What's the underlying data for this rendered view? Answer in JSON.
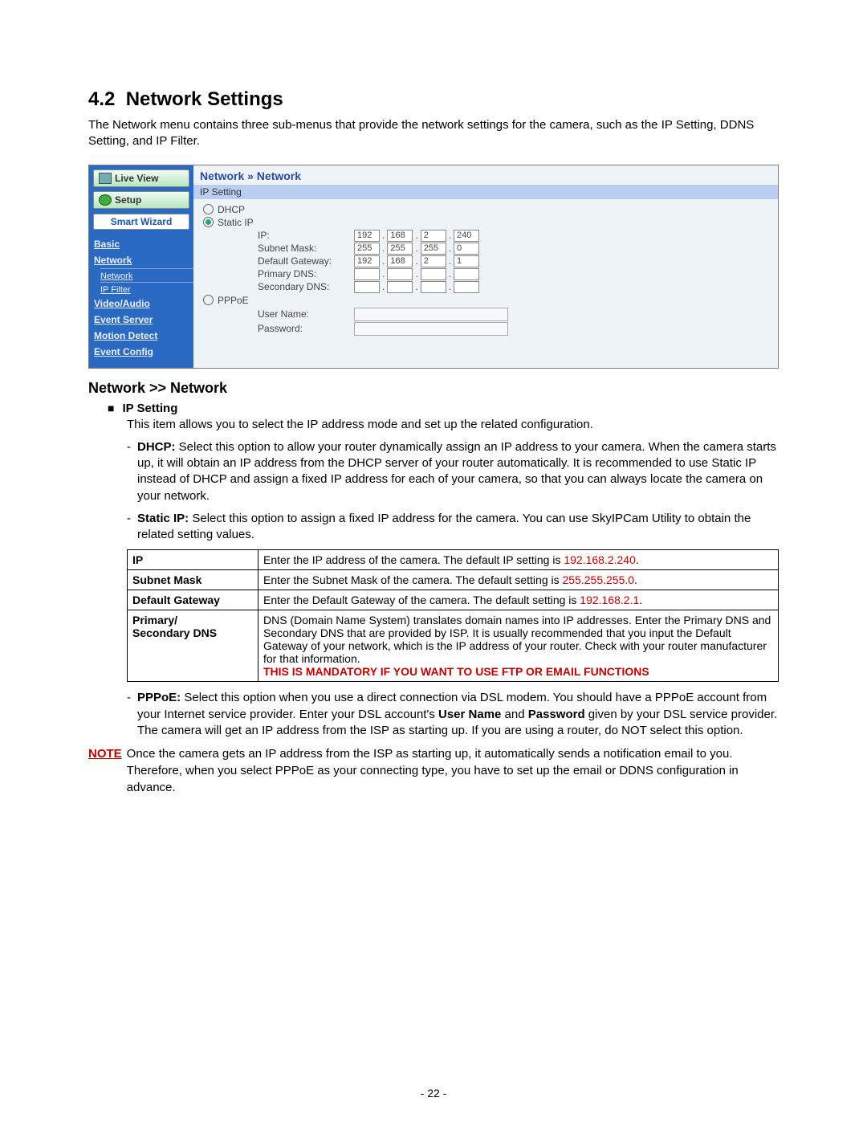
{
  "section": {
    "number": "4.2",
    "title": "Network Settings",
    "intro": "The Network menu contains three sub-menus that provide the network settings for the camera, such as the IP Setting, DDNS Setting, and IP Filter."
  },
  "ui": {
    "sidebar": {
      "live_view": "Live View",
      "setup": "Setup",
      "smart_wizard": "Smart Wizard",
      "items": [
        "Basic",
        "Network",
        "Video/Audio",
        "Event Server",
        "Motion Detect",
        "Event Config"
      ],
      "network_sub": [
        "Network",
        "IP Filter"
      ]
    },
    "breadcrumb": "Network » Network",
    "banner": "IP Setting",
    "radios": {
      "dhcp": "DHCP",
      "static": "Static IP",
      "pppoe": "PPPoE"
    },
    "labels": {
      "ip": "IP:",
      "subnet": "Subnet Mask:",
      "gateway": "Default Gateway:",
      "pdns": "Primary DNS:",
      "sdns": "Secondary DNS:",
      "username": "User Name:",
      "password": "Password:"
    },
    "values": {
      "ip": [
        "192",
        "168",
        "2",
        "240"
      ],
      "subnet": [
        "255",
        "255",
        "255",
        "0"
      ],
      "gateway": [
        "192",
        "168",
        "2",
        "1"
      ],
      "pdns": [
        "",
        "",
        "",
        ""
      ],
      "sdns": [
        "",
        "",
        "",
        ""
      ]
    }
  },
  "subhead": "Network >> Network",
  "ipsetting": {
    "title": "IP Setting",
    "desc": "This item allows you to select the IP address mode and set up the related configuration.",
    "dhcp_label": "DHCP:",
    "dhcp_text": " Select this option to allow your router dynamically assign an IP address to your camera. When the camera starts up, it will obtain an IP address from the DHCP server of your router automatically.  It is recommended to use Static IP instead of DHCP and assign a fixed IP address for each of your camera, so that you can always locate the camera on your network.",
    "static_label": "Static IP:",
    "static_text": " Select this option to assign a fixed IP address for the camera. You can use SkyIPCam Utility to obtain the related setting values."
  },
  "table": {
    "rows": [
      {
        "k": "IP",
        "prefix": "Enter the IP address of the camera. The default IP setting is ",
        "red": "192.168.2.240",
        "suffix": "."
      },
      {
        "k": "Subnet Mask",
        "prefix": "Enter the Subnet Mask of the camera. The default setting is ",
        "red": "255.255.255.0",
        "suffix": "."
      },
      {
        "k": "Default Gateway",
        "prefix": "Enter the Default Gateway of the camera. The default setting is ",
        "red": "192.168.2.1",
        "suffix": "."
      }
    ],
    "dns_k1": "Primary/",
    "dns_k2": "Secondary DNS",
    "dns_text": "DNS (Domain Name System) translates domain names into IP addresses. Enter the Primary DNS and Secondary DNS that are provided by ISP.  It is usually recommended that you input the Default Gateway of your network, which is the IP address of your router.  Check with your router manufacturer for that information.",
    "dns_red": "THIS IS MANDATORY IF YOU WANT TO USE FTP OR EMAIL FUNCTIONS"
  },
  "pppoe": {
    "label": "PPPoE:",
    "text1": " Select this option when you use a direct connection via  DSL modem. You should have a PPPoE account from your Internet service provider. Enter your DSL account's ",
    "b1": "User Name",
    "text2": " and ",
    "b2": "Password",
    "text3": " given by your DSL service provider. The camera will get an IP address from the ISP as starting up.  If you are using a router, do NOT select this option."
  },
  "note": {
    "label": "NOTE",
    "text": "Once the camera gets an IP address from the ISP as starting up, it automatically sends a notification email to you. Therefore, when you select PPPoE as your connecting type, you have to set up the email or DDNS configuration in advance."
  },
  "page_number": "- 22 -"
}
